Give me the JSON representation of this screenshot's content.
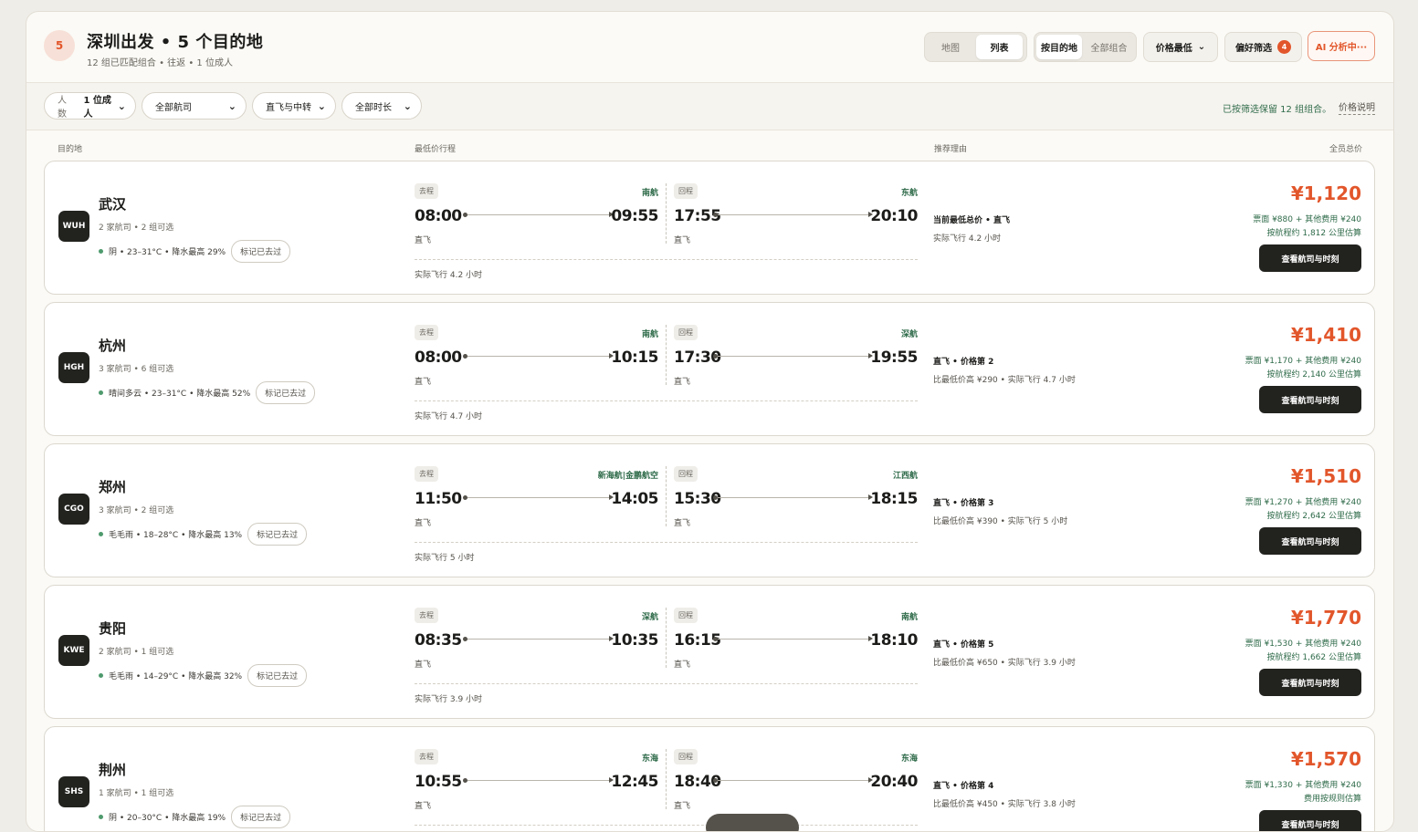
{
  "header": {
    "badge": "5",
    "title": "深圳出发 • 5 个目的地",
    "subtitle": "12 组已匹配组合 • 往返 • 1 位成人",
    "view_map": "地图",
    "view_list": "列表",
    "group_dest": "按目的地",
    "group_all": "全部组合",
    "sort_label": "价格最低",
    "pref_label": "偏好筛选",
    "pref_count": "4",
    "ai_label": "AI 分析中···"
  },
  "filters": {
    "people_label": "人数",
    "people_value": "1 位成人",
    "airline": "全部航司",
    "stops": "直飞与中转",
    "duration": "全部时长",
    "note": "已按筛选保留 12 组组合。",
    "price_help": "价格说明"
  },
  "columns": {
    "destination": "目的地",
    "itinerary": "最低价行程",
    "reason": "推荐理由",
    "total": "全员总价"
  },
  "cards": [
    {
      "code": "WUH",
      "city": "武汉",
      "meta": "2 家航司 • 2 组可选",
      "weather": "阴 • 23–31°C • 降水最高 29%",
      "mark": "标记已去过",
      "out": {
        "tag": "去程",
        "airline": "南航",
        "dep": "08:00",
        "arr": "09:55",
        "kind": "直飞"
      },
      "ret": {
        "tag": "回程",
        "airline": "东航",
        "dep": "17:55",
        "arr": "20:10",
        "kind": "直飞"
      },
      "actual": "实际飞行 4.2 小时",
      "reason": "当前最低总价 • 直飞",
      "reason_sub": "实际飞行 4.2 小时",
      "price": "¥1,120",
      "price_detail": "票面 ¥880 + 其他费用 ¥240",
      "price_note": "按航程约 1,812 公里估算",
      "cta": "查看航司与时刻"
    },
    {
      "code": "HGH",
      "city": "杭州",
      "meta": "3 家航司 • 6 组可选",
      "weather": "晴间多云 • 23–31°C • 降水最高 52%",
      "mark": "标记已去过",
      "out": {
        "tag": "去程",
        "airline": "南航",
        "dep": "08:00",
        "arr": "10:15",
        "kind": "直飞"
      },
      "ret": {
        "tag": "回程",
        "airline": "深航",
        "dep": "17:30",
        "arr": "19:55",
        "kind": "直飞"
      },
      "actual": "实际飞行 4.7 小时",
      "reason": "直飞 • 价格第 2",
      "reason_sub": "比最低价高 ¥290 • 实际飞行 4.7 小时",
      "price": "¥1,410",
      "price_detail": "票面 ¥1,170 + 其他费用 ¥240",
      "price_note": "按航程约 2,140 公里估算",
      "cta": "查看航司与时刻"
    },
    {
      "code": "CGO",
      "city": "郑州",
      "meta": "3 家航司 • 2 组可选",
      "weather": "毛毛雨 • 18–28°C • 降水最高 13%",
      "mark": "标记已去过",
      "out": {
        "tag": "去程",
        "airline": "新海航|金鹏航空",
        "dep": "11:50",
        "arr": "14:05",
        "kind": "直飞"
      },
      "ret": {
        "tag": "回程",
        "airline": "江西航",
        "dep": "15:30",
        "arr": "18:15",
        "kind": "直飞"
      },
      "actual": "实际飞行 5 小时",
      "reason": "直飞 • 价格第 3",
      "reason_sub": "比最低价高 ¥390 • 实际飞行 5 小时",
      "price": "¥1,510",
      "price_detail": "票面 ¥1,270 + 其他费用 ¥240",
      "price_note": "按航程约 2,642 公里估算",
      "cta": "查看航司与时刻"
    },
    {
      "code": "KWE",
      "city": "贵阳",
      "meta": "2 家航司 • 1 组可选",
      "weather": "毛毛雨 • 14–29°C • 降水最高 32%",
      "mark": "标记已去过",
      "out": {
        "tag": "去程",
        "airline": "深航",
        "dep": "08:35",
        "arr": "10:35",
        "kind": "直飞"
      },
      "ret": {
        "tag": "回程",
        "airline": "南航",
        "dep": "16:15",
        "arr": "18:10",
        "kind": "直飞"
      },
      "actual": "实际飞行 3.9 小时",
      "reason": "直飞 • 价格第 5",
      "reason_sub": "比最低价高 ¥650 • 实际飞行 3.9 小时",
      "price": "¥1,770",
      "price_detail": "票面 ¥1,530 + 其他费用 ¥240",
      "price_note": "按航程约 1,662 公里估算",
      "cta": "查看航司与时刻"
    },
    {
      "code": "SHS",
      "city": "荆州",
      "meta": "1 家航司 • 1 组可选",
      "weather": "阴 • 20–30°C • 降水最高 19%",
      "mark": "标记已去过",
      "out": {
        "tag": "去程",
        "airline": "东海",
        "dep": "10:55",
        "arr": "12:45",
        "kind": "直飞"
      },
      "ret": {
        "tag": "回程",
        "airline": "东海",
        "dep": "18:40",
        "arr": "20:40",
        "kind": "直飞"
      },
      "actual": "",
      "reason": "直飞 • 价格第 4",
      "reason_sub": "比最低价高 ¥450 • 实际飞行 3.8 小时",
      "price": "¥1,570",
      "price_detail": "票面 ¥1,330 + 其他费用 ¥240",
      "price_note": "费用按规则估算",
      "cta": "查看航司与时刻"
    }
  ]
}
